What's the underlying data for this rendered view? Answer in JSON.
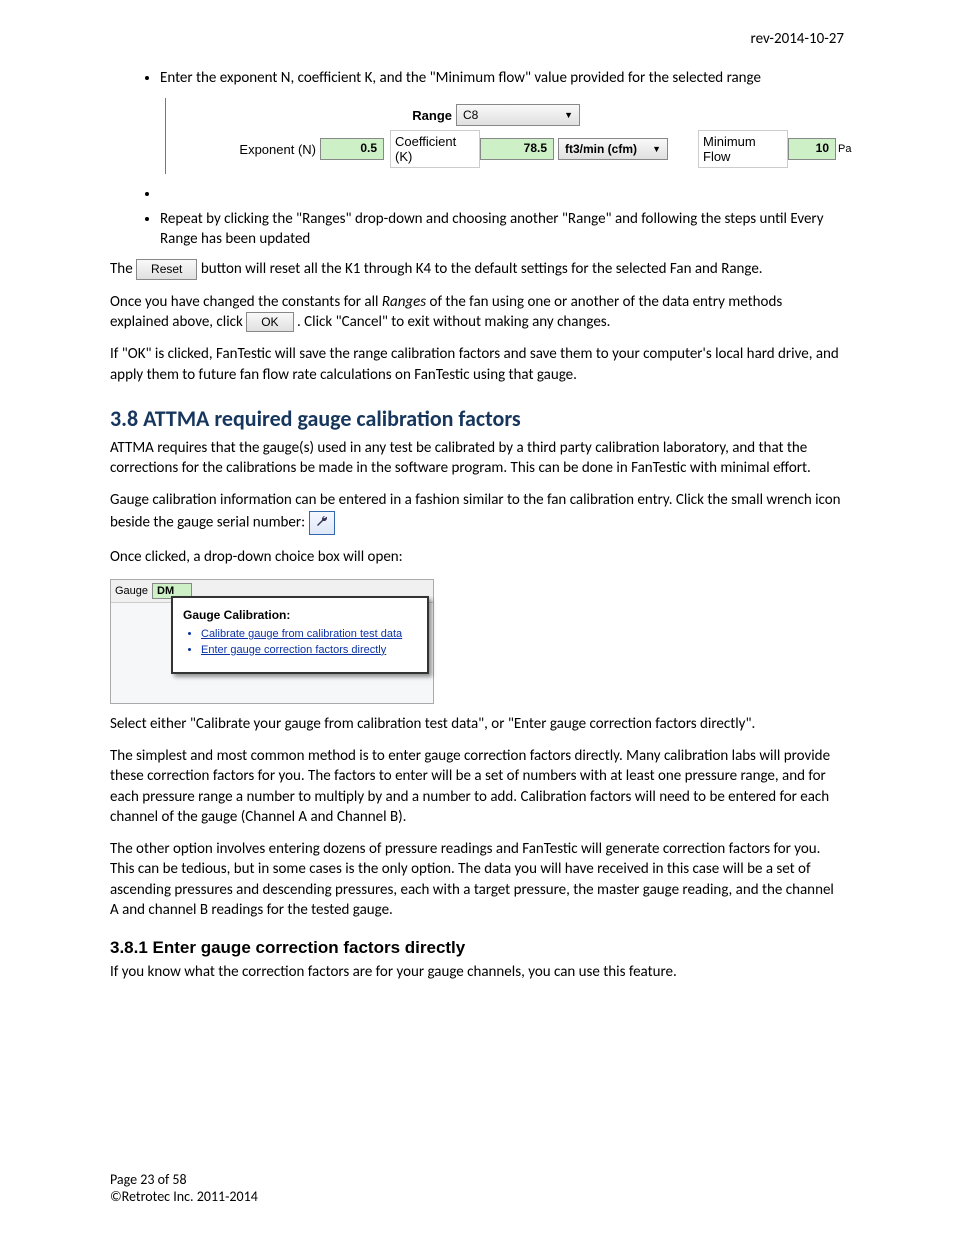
{
  "header": {
    "rev": "rev-2014-10-27"
  },
  "bullets_top": {
    "b1": "Enter the exponent N, coefficient K, and the \"Minimum flow\" value provided for the selected range",
    "b2": "",
    "b3": "Repeat by clicking the \"Ranges\" drop-down and choosing another \"Range\" and following the steps until Every Range has been updated"
  },
  "ui": {
    "range_label": "Range",
    "range_value": "C8",
    "exp_label": "Exponent (N)",
    "exp_value": "0.5",
    "coef_label": "Coefficient (K)",
    "coef_value": "78.5",
    "units_value": "ft3/min (cfm)",
    "minflow_label": "Minimum Flow",
    "minflow_value": "10",
    "minflow_unit": "Pa"
  },
  "para": {
    "p1a": "The ",
    "reset_btn": "Reset",
    "p1b": " button will reset all the K1 through K4 to the default settings for the selected Fan and Range.",
    "p2a": "Once you have changed the constants for all ",
    "p2_em": "Ranges",
    "p2b": " of the fan using one or another of the data entry methods explained above, click ",
    "ok_btn": "OK",
    "p2c": ".  Click \"Cancel\" to exit without making any changes.",
    "p3": "If \"OK\" is clicked, FanTestic will save the range calibration factors and save them to your computer's local hard drive, and apply them to future fan flow rate calculations on FanTestic using that gauge."
  },
  "h2": "3.8  ATTMA required gauge calibration factors",
  "sec38": {
    "p1": "ATTMA requires that the gauge(s) used in any test be calibrated by a third party calibration laboratory, and that the corrections for the calibrations be made in the software program. This can be done in FanTestic with minimal effort.",
    "p2": "Gauge calibration information can be entered in a fashion similar to the fan calibration entry.  Click the small wrench icon beside the gauge serial number: ",
    "p3": "Once clicked,  a drop-down choice box will open:"
  },
  "popup": {
    "gauge_label": "Gauge",
    "gauge_value": "DM",
    "title": "Gauge Calibration:",
    "opt1": "Calibrate gauge from calibration test data",
    "opt2": "Enter gauge correction factors directly"
  },
  "sec38b": {
    "p4": "Select either \"Calibrate your gauge from calibration test data\", or \"Enter gauge correction factors directly\".",
    "p5": "The simplest and most common method is to enter gauge correction factors directly.  Many calibration labs will provide these correction factors for you.  The factors to enter will be a set of numbers with at least one pressure range, and for each pressure range a number to multiply by and a number to add. Calibration factors will need to be entered for each channel of the gauge (Channel A and Channel B).",
    "p6": "The other option involves entering dozens of pressure readings and FanTestic will generate correction factors for you.  This can be tedious, but in some cases is the only option.  The data you will have received in this case will be a set of ascending pressures and descending pressures, each with a target pressure, the master gauge reading, and the channel A and channel B readings for the tested gauge."
  },
  "h3": "3.8.1  Enter gauge correction factors directly",
  "sec381": {
    "p1": "If you know what the correction factors are for your gauge channels, you can use this feature."
  },
  "footer": {
    "page": "Page 23 of 58",
    "copyright": "©Retrotec Inc. 2011-2014"
  }
}
